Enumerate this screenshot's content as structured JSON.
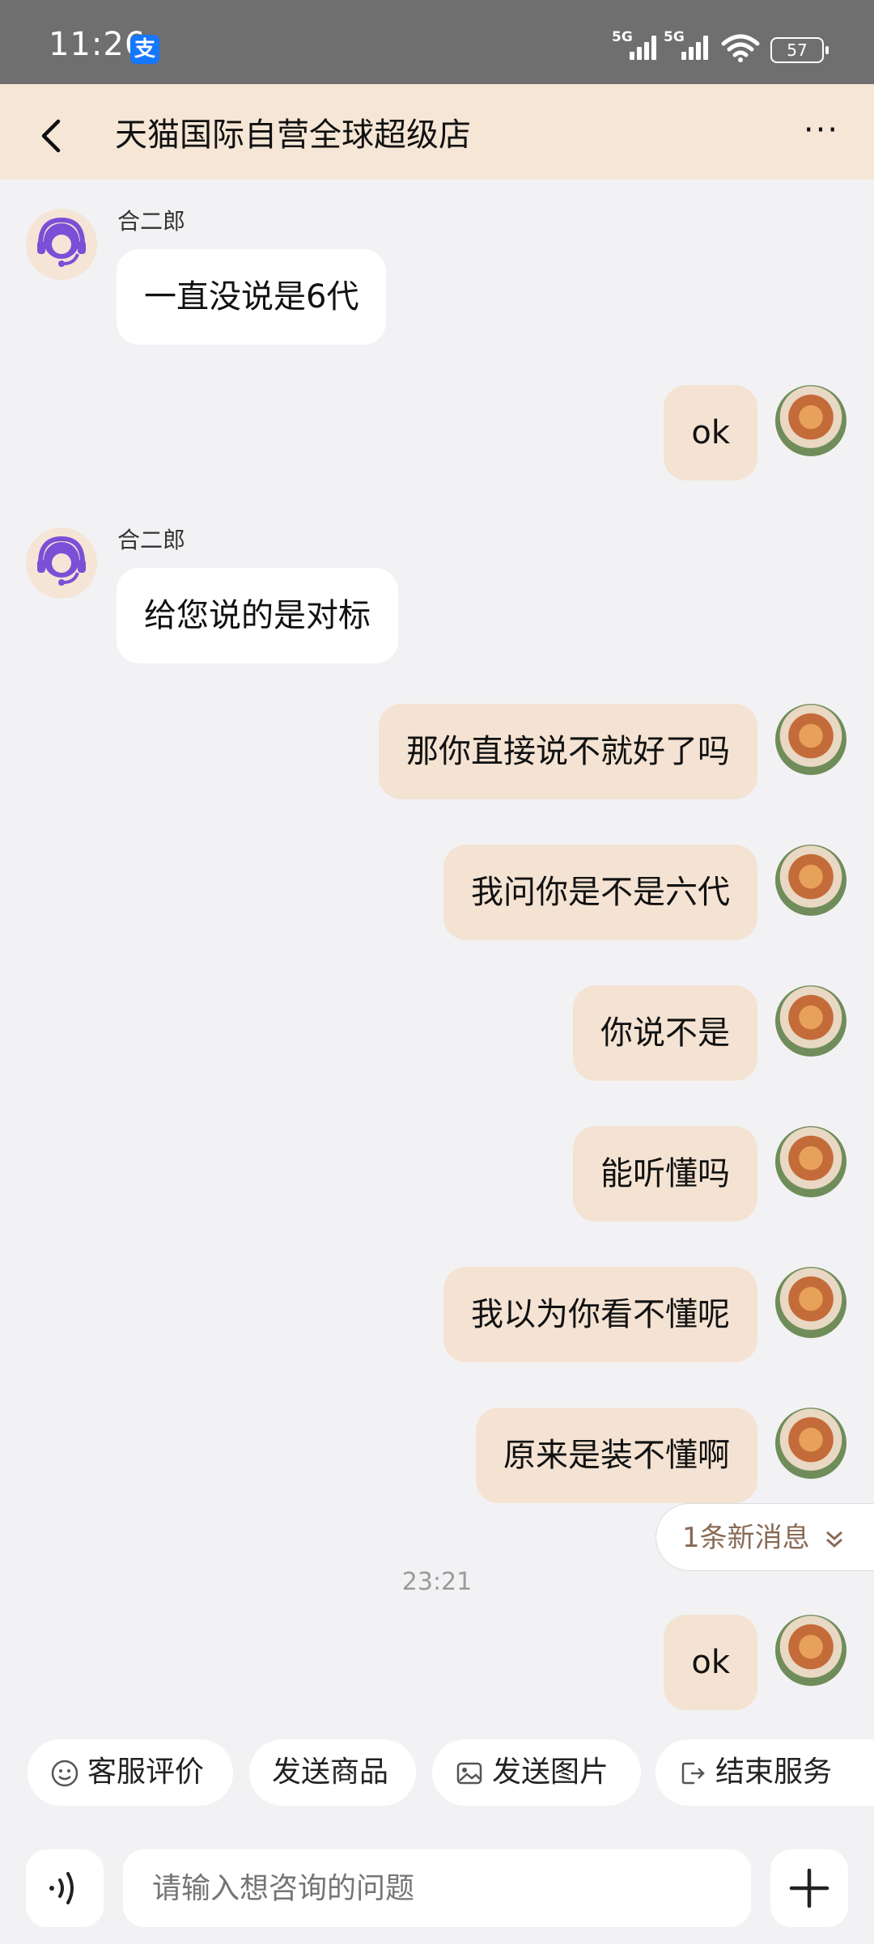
{
  "status_bar": {
    "time": "11:26",
    "alipay_glyph": "支",
    "signal1_label": "5G",
    "signal2_label": "5G",
    "battery": "57"
  },
  "header": {
    "title": "天猫国际自营全球超级店",
    "more_glyph": "···"
  },
  "messages": [
    {
      "side": "in",
      "sender": "合二郎",
      "text": "一直没说是6代"
    },
    {
      "side": "out",
      "text": "ok"
    },
    {
      "side": "in",
      "sender": "合二郎",
      "text": "给您说的是对标"
    },
    {
      "side": "out",
      "text": "那你直接说不就好了吗"
    },
    {
      "side": "out",
      "text": "我问你是不是六代"
    },
    {
      "side": "out",
      "text": "你说不是"
    },
    {
      "side": "out",
      "text": "能听懂吗"
    },
    {
      "side": "out",
      "text": "我以为你看不懂呢"
    },
    {
      "side": "out",
      "text": "原来是装不懂啊"
    },
    {
      "side": "out",
      "text": "ok"
    }
  ],
  "timestamp": "23:21",
  "new_message_pill": "1条新消息",
  "quick_actions": {
    "rate": "客服评价",
    "send_product": "发送商品",
    "send_image": "发送图片",
    "end_service": "结束服务"
  },
  "input": {
    "placeholder": "请输入想咨询的问题"
  },
  "colors": {
    "header_bg": "#f6e6d6",
    "out_bubble": "#f4e3d3",
    "in_bubble": "#ffffff",
    "page_bg": "#f2f2f4",
    "agent_avatar_purple": "#7b4fd6"
  }
}
